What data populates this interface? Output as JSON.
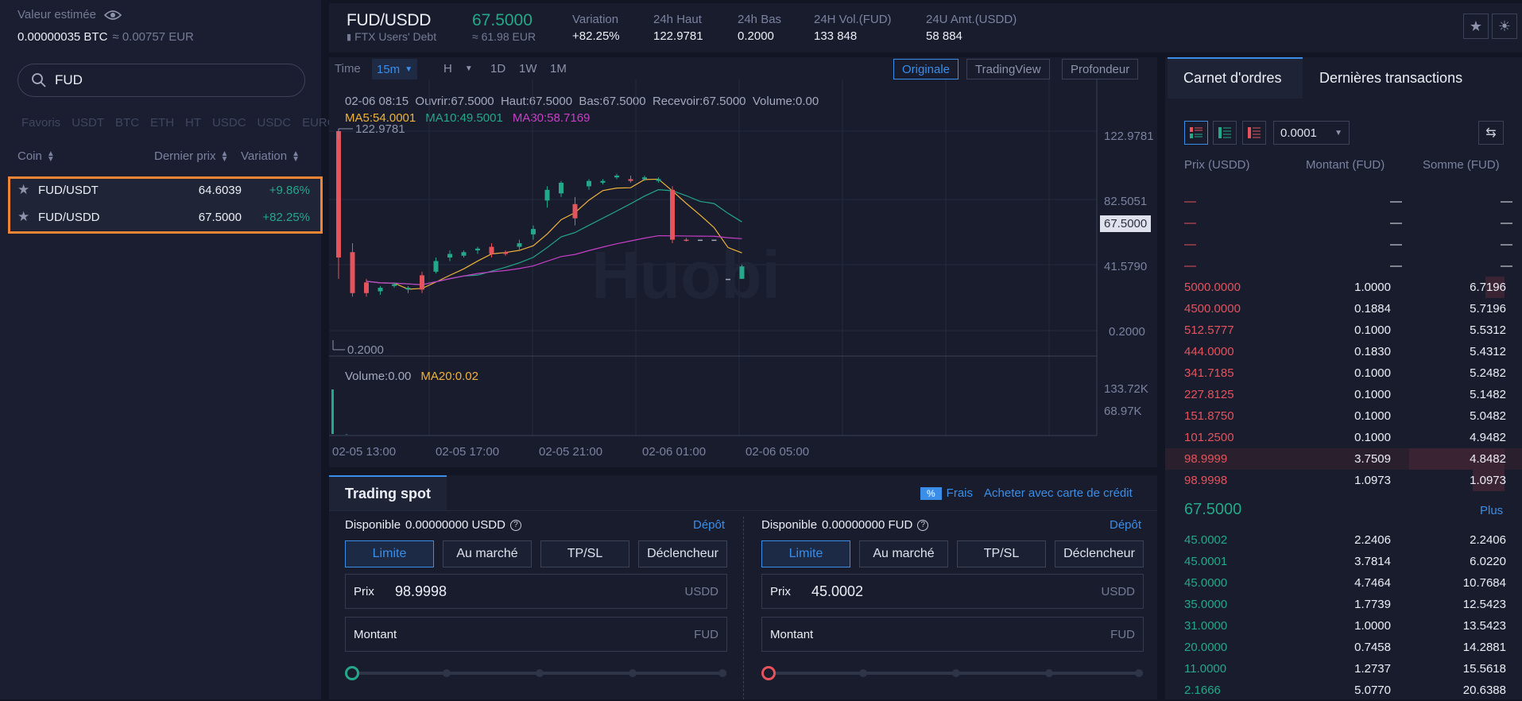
{
  "sidebar": {
    "est_label": "Valeur estimée",
    "est_value": "0.00000035 BTC",
    "est_eur": "≈ 0.00757 EUR",
    "search_value": "FUD",
    "quote_tabs": [
      "Favoris",
      "USDT",
      "BTC",
      "ETH",
      "HT",
      "USDC",
      "USDC",
      "EURO"
    ],
    "col_coin": "Coin",
    "col_price": "Dernier prix",
    "col_change": "Variation",
    "pairs": [
      {
        "name": "FUD/USDT",
        "price": "64.6039",
        "change": "+9.86%"
      },
      {
        "name": "FUD/USDD",
        "price": "67.5000",
        "change": "+82.25%"
      }
    ]
  },
  "header": {
    "pair": "FUD/USDD",
    "subtitle": "FTX Users' Debt",
    "price": "67.5000",
    "price_eur": "≈ 61.98 EUR",
    "stats": [
      {
        "label": "Variation",
        "value": "+82.25%"
      },
      {
        "label": "24h Haut",
        "value": "122.9781"
      },
      {
        "label": "24h Bas",
        "value": "0.2000"
      },
      {
        "label": "24H Vol.(FUD)",
        "value": "133 848"
      },
      {
        "label": "24U Amt.(USDD)",
        "value": "58 884"
      }
    ]
  },
  "chart": {
    "toolbar": {
      "time": "Time",
      "interval": "15m",
      "h": "H",
      "d1": "1D",
      "w1": "1W",
      "m1": "1M",
      "views": [
        "Originale",
        "TradingView",
        "Profondeur"
      ]
    },
    "ohlc": "02-06 08:15  Ouvrir:67.5000  Haut:67.5000  Bas:67.5000  Recevoir:67.5000  Volume:0.00",
    "ma5": "MA5:54.0001",
    "ma10": "MA10:49.5001",
    "ma30": "MA30:58.7169",
    "high_mark": "122.9781",
    "low_mark": "0.2000",
    "price_ticks": [
      "122.9781",
      "82.5051",
      "67.5000",
      "41.5790",
      "0.2000"
    ],
    "volume_label": "Volume:0.00",
    "ma20": "MA20:0.02",
    "vol_ticks": [
      "133.72K",
      "68.97K"
    ],
    "time_ticks": [
      "02-05 13:00",
      "02-05 17:00",
      "02-05 21:00",
      "02-06 01:00",
      "02-06 05:00"
    ],
    "watermark": "Huobi",
    "colors": {
      "up": "#25a78a",
      "down": "#e5535c",
      "ma5": "#f0b33a",
      "ma10": "#25a78a",
      "ma30": "#c83fc8"
    }
  },
  "chart_data": {
    "type": "candlestick",
    "interval": "15m",
    "y_range": [
      0.2,
      122.9781
    ],
    "last_price": 67.5,
    "ma5": 54.0001,
    "ma10": 49.5001,
    "ma30": 58.7169,
    "volume_ma20": 0.02,
    "candles": [
      {
        "o": 122.98,
        "h": 122.98,
        "l": 40,
        "c": 52,
        "dir": "down"
      },
      {
        "o": 55,
        "h": 60,
        "l": 30,
        "c": 32,
        "dir": "down"
      },
      {
        "o": 38,
        "h": 40,
        "l": 30,
        "c": 32,
        "dir": "down"
      },
      {
        "o": 33,
        "h": 36,
        "l": 31,
        "c": 35,
        "dir": "up"
      },
      {
        "o": 36,
        "h": 38,
        "l": 35,
        "c": 37,
        "dir": "up"
      },
      {
        "o": 34,
        "h": 36,
        "l": 32,
        "c": 35,
        "dir": "up"
      },
      {
        "o": 42,
        "h": 44,
        "l": 32,
        "c": 34,
        "dir": "down"
      },
      {
        "o": 44,
        "h": 52,
        "l": 43,
        "c": 50,
        "dir": "up"
      },
      {
        "o": 52,
        "h": 56,
        "l": 50,
        "c": 54,
        "dir": "up"
      },
      {
        "o": 53,
        "h": 56,
        "l": 52,
        "c": 55,
        "dir": "up"
      },
      {
        "o": 56,
        "h": 58,
        "l": 54,
        "c": 57,
        "dir": "up"
      },
      {
        "o": 58,
        "h": 60,
        "l": 52,
        "c": 54,
        "dir": "down"
      },
      {
        "o": 55,
        "h": 56,
        "l": 53,
        "c": 54,
        "dir": "down"
      },
      {
        "o": 58,
        "h": 62,
        "l": 56,
        "c": 60,
        "dir": "up"
      },
      {
        "o": 65,
        "h": 70,
        "l": 62,
        "c": 68,
        "dir": "up"
      },
      {
        "o": 84,
        "h": 92,
        "l": 80,
        "c": 90,
        "dir": "up"
      },
      {
        "o": 88,
        "h": 95,
        "l": 86,
        "c": 94,
        "dir": "up"
      },
      {
        "o": 82,
        "h": 86,
        "l": 70,
        "c": 74,
        "dir": "down"
      },
      {
        "o": 92,
        "h": 96,
        "l": 90,
        "c": 95,
        "dir": "up"
      },
      {
        "o": 94,
        "h": 96,
        "l": 93,
        "c": 95,
        "dir": "up"
      },
      {
        "o": 98,
        "h": 99,
        "l": 96,
        "c": 97,
        "dir": "up"
      },
      {
        "o": 96,
        "h": 98,
        "l": 94,
        "c": 95,
        "dir": "down"
      },
      {
        "o": 96,
        "h": 98,
        "l": 95,
        "c": 97,
        "dir": "up"
      },
      {
        "o": 95,
        "h": 97,
        "l": 94,
        "c": 96,
        "dir": "up"
      },
      {
        "o": 90,
        "h": 92,
        "l": 60,
        "c": 62,
        "dir": "down"
      },
      {
        "o": 62,
        "h": 63,
        "l": 61,
        "c": 62,
        "dir": "down"
      },
      {
        "o": 62,
        "h": 62,
        "l": 62,
        "c": 62,
        "dir": "flat"
      },
      {
        "o": 62,
        "h": 62,
        "l": 62,
        "c": 62,
        "dir": "flat"
      },
      {
        "o": 40,
        "h": 40,
        "l": 40,
        "c": 40,
        "dir": "flat"
      },
      {
        "o": 40,
        "h": 48,
        "l": 40,
        "c": 47,
        "dir": "up"
      }
    ],
    "volume": [
      {
        "v": 133720
      },
      {
        "v": 0
      }
    ]
  },
  "book": {
    "tab_book": "Carnet d'ordres",
    "tab_trades": "Dernières transactions",
    "precision": "0.0001",
    "col_price": "Prix (USDD)",
    "col_amount": "Montant (FUD)",
    "col_sum": "Somme (FUD)",
    "dash": "—",
    "asks": [
      {
        "p": "5000.0000",
        "a": "1.0000",
        "s": "6.7196",
        "d": 0.2
      },
      {
        "p": "4500.0000",
        "a": "0.1884",
        "s": "5.7196",
        "d": 0
      },
      {
        "p": "512.5777",
        "a": "0.1000",
        "s": "5.5312",
        "d": 0
      },
      {
        "p": "444.0000",
        "a": "0.1830",
        "s": "5.4312",
        "d": 0
      },
      {
        "p": "341.7185",
        "a": "0.1000",
        "s": "5.2482",
        "d": 0
      },
      {
        "p": "227.8125",
        "a": "0.1000",
        "s": "5.1482",
        "d": 0
      },
      {
        "p": "151.8750",
        "a": "0.1000",
        "s": "5.0482",
        "d": 0
      },
      {
        "p": "101.2500",
        "a": "0.1000",
        "s": "4.9482",
        "d": 0
      },
      {
        "p": "98.9999",
        "a": "3.7509",
        "s": "4.8482",
        "d": 1
      },
      {
        "p": "98.9998",
        "a": "1.0973",
        "s": "1.0973",
        "d": 0.33
      }
    ],
    "mid": "67.5000",
    "more": "Plus",
    "bids": [
      {
        "p": "45.0002",
        "a": "2.2406",
        "s": "2.2406"
      },
      {
        "p": "45.0001",
        "a": "3.7814",
        "s": "6.0220"
      },
      {
        "p": "45.0000",
        "a": "4.7464",
        "s": "10.7684"
      },
      {
        "p": "35.0000",
        "a": "1.7739",
        "s": "12.5423"
      },
      {
        "p": "31.0000",
        "a": "1.0000",
        "s": "13.5423"
      },
      {
        "p": "20.0000",
        "a": "0.7458",
        "s": "14.2881"
      },
      {
        "p": "11.0000",
        "a": "1.2737",
        "s": "15.5618"
      },
      {
        "p": "2.1666",
        "a": "5.0770",
        "s": "20.6388"
      }
    ]
  },
  "trade": {
    "title": "Trading spot",
    "fees_badge": "%",
    "fees": "Frais",
    "card": "Acheter avec carte de crédit",
    "buy": {
      "avail_label": "Disponible",
      "avail": "0.00000000 USDD",
      "deposit": "Dépôt",
      "price": "98.9998",
      "price_unit": "USDD",
      "amount_unit": "FUD"
    },
    "sell": {
      "avail_label": "Disponible",
      "avail": "0.00000000 FUD",
      "deposit": "Dépôt",
      "price": "45.0002",
      "price_unit": "USDD",
      "amount_unit": "FUD"
    },
    "order_types": [
      "Limite",
      "Au marché",
      "TP/SL",
      "Déclencheur"
    ],
    "price_label": "Prix",
    "amount_label": "Montant"
  }
}
